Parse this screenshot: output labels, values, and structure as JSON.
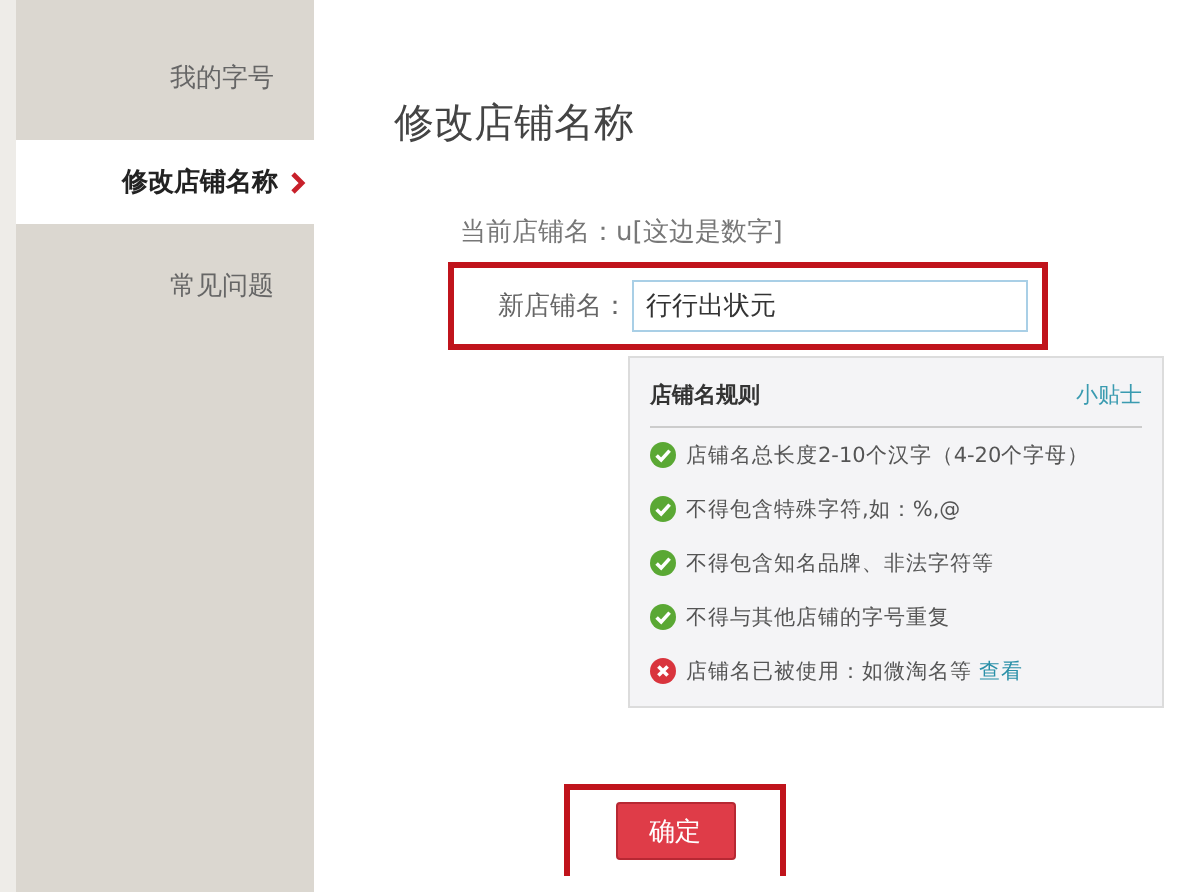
{
  "sidebar": {
    "items": [
      {
        "label": "我的字号",
        "selected": false
      },
      {
        "label": "修改店铺名称",
        "selected": true
      },
      {
        "label": "常见问题",
        "selected": false
      }
    ]
  },
  "title": "修改店铺名称",
  "current_name": "当前店铺名：u[这边是数字]",
  "new_name": {
    "label": "新店铺名：",
    "value": "行行出状元",
    "highlighted": true
  },
  "rules": {
    "title": "店铺名规则",
    "tip": "小贴士",
    "items": [
      {
        "kind": "pass",
        "text": "店铺名总长度2-10个汉字（4-20个字母）"
      },
      {
        "kind": "pass",
        "text": "不得包含特殊字符,如：%,@"
      },
      {
        "kind": "pass",
        "text": "不得包含知名品牌、非法字符等"
      },
      {
        "kind": "pass",
        "text": "不得与其他店铺的字号重复"
      },
      {
        "kind": "fail",
        "text": "店铺名已被使用：如微淘名等",
        "link": "查看"
      }
    ]
  },
  "confirm": {
    "label": "确定",
    "highlighted": true
  }
}
